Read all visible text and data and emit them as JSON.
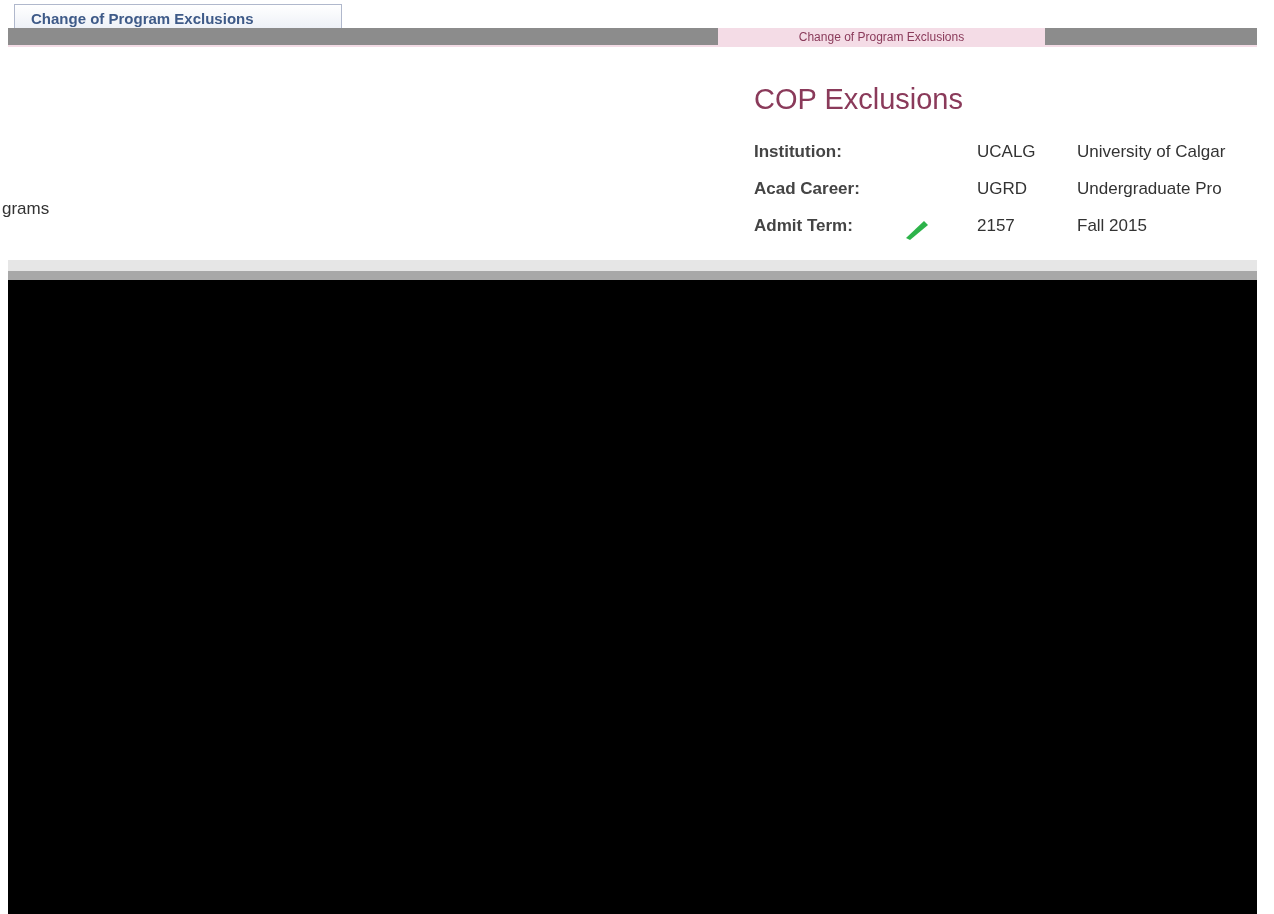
{
  "top_tab": {
    "label": "Change of Program Exclusions"
  },
  "bar_tab": {
    "label": "Change of Program Exclusions",
    "selected": true
  },
  "left_fragment": "grams",
  "heading": "COP Exclusions",
  "fields": [
    {
      "label": "Institution:",
      "code": "UCALG",
      "description": "University of Calgar"
    },
    {
      "label": "Acad Career:",
      "code": "UGRD",
      "description": "Undergraduate Pro"
    },
    {
      "label": "Admit Term:",
      "code": "2157",
      "description": "Fall 2015"
    }
  ]
}
